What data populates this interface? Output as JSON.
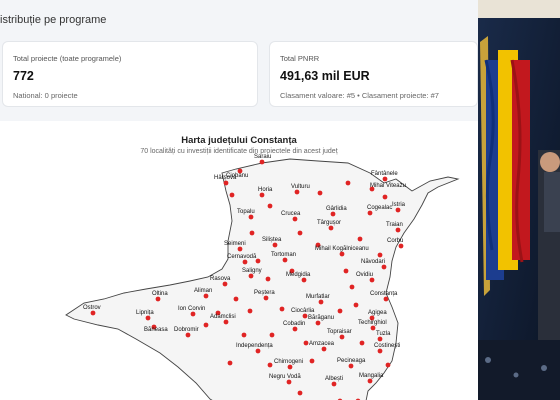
{
  "section": {
    "heading": "istribuție pe programe"
  },
  "cards": [
    {
      "label": "Total proiecte (toate programele)",
      "value": "772",
      "sub": "National: 0 proiecte"
    },
    {
      "label": "Total PNRR",
      "value": "491,63 mil EUR",
      "sub": "Clasament valoare: #5 • Clasament proiecte: #7"
    }
  ],
  "map": {
    "title": "Harta județului Constanța",
    "subtitle": "70 localități cu investiții identificate din proiectele din acest județ",
    "marker_color": "#e02424",
    "localities": [
      "Ciobanu",
      "Saraiu",
      "Hârșova",
      "Horia",
      "Vulturu",
      "Fântânele",
      "Mihai Viteazu",
      "Gârlidia",
      "Cogealac",
      "Istria",
      "Topalu",
      "Crucea",
      "Târgușor",
      "Traian",
      "Seimeni",
      "Siliștea",
      "Mihail Kogălniceanu",
      "Corbu",
      "Cernavodă",
      "Tortoman",
      "Năvodari",
      "Saligny",
      "Medgidia",
      "Ovidiu",
      "Rasova",
      "Peștera",
      "Murfatlar",
      "Constanța",
      "Oltina",
      "Aliman",
      "Ion Corvin",
      "Ciocârlia",
      "Agigea",
      "Ostrov",
      "Lipnița",
      "Adamclisi",
      "Cobadin",
      "Bărăganu",
      "Techirghiol",
      "Băneasa",
      "Dobromir",
      "Topraisar",
      "Tuzla",
      "Independența",
      "Amzacea",
      "Costinești",
      "Chirnogeni",
      "Pecineaga",
      "Negru Vodă",
      "Albești",
      "Mangalia"
    ]
  }
}
